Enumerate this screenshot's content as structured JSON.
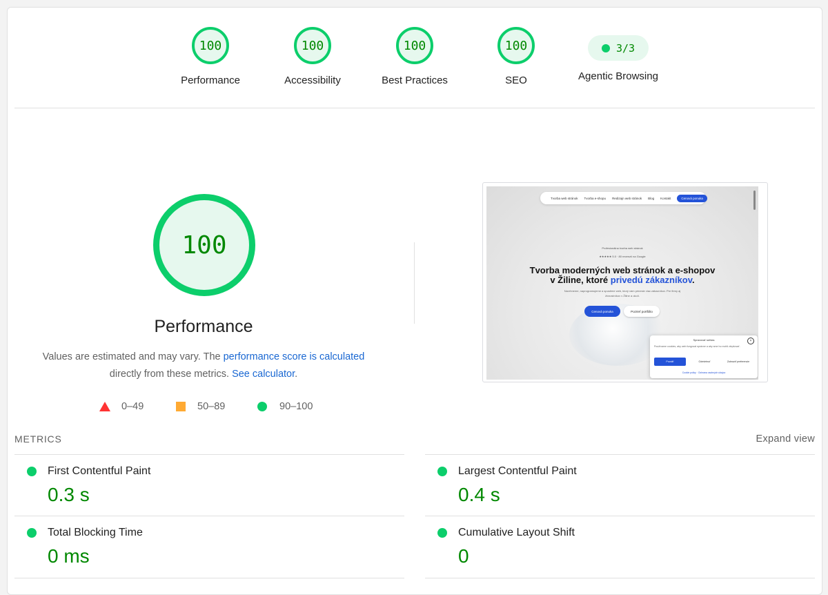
{
  "colors": {
    "pass": "#0cce6b",
    "pass_text": "#008800",
    "average": "#ffaa33",
    "fail": "#ff3333",
    "link": "#1967d2"
  },
  "gauges": [
    {
      "score": "100",
      "label": "Performance"
    },
    {
      "score": "100",
      "label": "Accessibility"
    },
    {
      "score": "100",
      "label": "Best Practices"
    },
    {
      "score": "100",
      "label": "SEO"
    }
  ],
  "agentic": {
    "score": "3/3",
    "label": "Agentic Browsing"
  },
  "performance": {
    "score": "100",
    "title": "Performance",
    "desc_prefix": "Values are estimated and may vary. The ",
    "desc_link1": "performance score is calculated",
    "desc_middle": " directly from these metrics. ",
    "desc_link2": "See calculator",
    "desc_suffix": "."
  },
  "legend": {
    "fail": "0–49",
    "average": "50–89",
    "pass": "90–100"
  },
  "screenshot": {
    "nav_items": [
      "Tvorba web stránok",
      "Tvorba e-shopu",
      "Redizajn web stránok",
      "Blog",
      "Kontakt"
    ],
    "nav_cta": "Cenová ponuka",
    "badge": "Profesionálna tvorba web stránok",
    "rating": "★★★★★ 5.0 · 80 recenzií na Google",
    "headline_1": "Tvorba moderných web stránok a e-shopov",
    "headline_2": "v Žiline, ktoré ",
    "headline_blue": "privedú zákazníkov",
    "headline_end": ".",
    "sub": "Navrhneme, naprogramujeme a spustíme web, ktorý vám prinesie viac zákazníkov. Pre firmy aj živnostníkov v Žiline a okolí.",
    "btn_primary": "Cenová ponuka",
    "btn_secondary": "Pozrieť portfólio",
    "cookie": {
      "title": "Spravovať súhlas",
      "text": "Používame cookies, aby web fungoval správne a aby sme ho mohli zlepšovať.",
      "accept": "Povoliť",
      "deny": "Odmietnuť",
      "prefs": "Zobraziť preferencie",
      "links": "Cookie policy · Ochrana osobných údajov"
    }
  },
  "metrics_section": {
    "label": "METRICS",
    "expand": "Expand view"
  },
  "metrics": [
    {
      "name": "First Contentful Paint",
      "value": "0.3 s"
    },
    {
      "name": "Largest Contentful Paint",
      "value": "0.4 s"
    },
    {
      "name": "Total Blocking Time",
      "value": "0 ms"
    },
    {
      "name": "Cumulative Layout Shift",
      "value": "0"
    }
  ]
}
